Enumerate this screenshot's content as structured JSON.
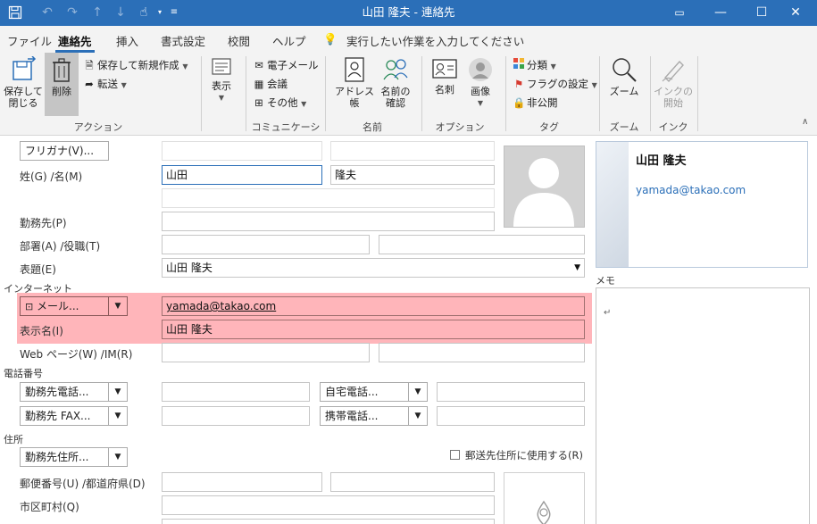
{
  "title_bar": {
    "title": "山田 隆夫 - 連絡先",
    "icons": [
      "save-icon",
      "undo-icon",
      "redo-icon",
      "up-icon",
      "down-icon",
      "touch-mode-icon",
      "customize-icon"
    ]
  },
  "tabs": [
    "ファイル",
    "連絡先",
    "挿入",
    "書式設定",
    "校閲",
    "ヘルプ"
  ],
  "tell_me": "実行したい作業を入力してください",
  "ribbon": {
    "save_close": "保存して\n閉じる",
    "delete": "削除",
    "save_new": "保存して新規作成",
    "forward": "転送",
    "group_action": "アクション",
    "show": "表示",
    "email": "電子メール",
    "meeting": "会議",
    "other": "その他",
    "group_comm": "コミュニケーション",
    "address_book": "アドレス帳",
    "check_names": "名前の\n確認",
    "group_names": "名前",
    "business_card": "名刺",
    "picture": "画像",
    "group_options": "オプション",
    "categorize": "分類",
    "follow_up": "フラグの設定",
    "private": "非公開",
    "group_tags": "タグ",
    "zoom": "ズーム",
    "group_zoom": "ズーム",
    "ink_start": "インクの\n開始",
    "group_ink": "インク"
  },
  "form": {
    "furigana_button": "フリガナ(V)...",
    "name_label": "姓(G) /名(M)",
    "last_name": "山田",
    "first_name": "隆夫",
    "company_label": "勤務先(P)",
    "dept_label": "部署(A) /役職(T)",
    "file_as_label": "表題(E)",
    "file_as_value": "山田 隆夫",
    "internet_section": "インターネット",
    "email_button": "メール...",
    "email_value": "yamada@takao.com",
    "display_label": "表示名(I)",
    "display_value": "山田 隆夫",
    "web_label": "Web ページ(W) /IM(R)",
    "phone_section": "電話番号",
    "phone1": "勤務先電話...",
    "phone2": "自宅電話...",
    "phone3": "勤務先 FAX...",
    "phone4": "携帯電話...",
    "address_section": "住所",
    "address_button": "勤務先住所...",
    "mailing_checkbox": "郵送先住所に使用する(R)",
    "zip_label": "郵便番号(U) /都道府県(D)",
    "city_label": "市区町村(Q)"
  },
  "card": {
    "name": "山田 隆夫",
    "email": "yamada@takao.com"
  },
  "notes_label": "メモ",
  "colors": {
    "title_bar": "#2b6fb8",
    "highlight": "#ff7882",
    "link": "#2b6fb8"
  }
}
